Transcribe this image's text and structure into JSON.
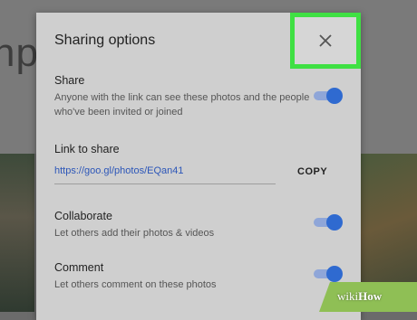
{
  "background": {
    "partial_text": "np"
  },
  "dialog": {
    "title": "Sharing options",
    "close_icon": "close-icon",
    "share": {
      "title": "Share",
      "description": "Anyone with the link can see these photos and the people who've been invited or joined",
      "enabled": true
    },
    "link": {
      "label": "Link to share",
      "url": "https://goo.gl/photos/EQan41",
      "copy_label": "COPY"
    },
    "collaborate": {
      "title": "Collaborate",
      "description": "Let others add their photos & videos",
      "enabled": true
    },
    "comment": {
      "title": "Comment",
      "description": "Let others comment on these photos",
      "enabled": true
    }
  },
  "watermark": {
    "prefix": "wiki",
    "suffix": "How"
  },
  "colors": {
    "accent": "#2f6ad0",
    "highlight": "#3fe043",
    "link": "#2c56b8"
  }
}
